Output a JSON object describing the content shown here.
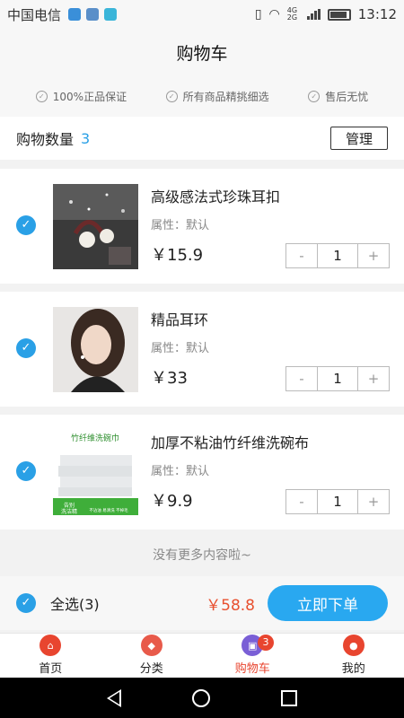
{
  "status_bar": {
    "carrier": "中国电信",
    "network": "4G 2G",
    "time": "13:12"
  },
  "header": {
    "title": "购物车"
  },
  "guarantees": [
    "100%正品保证",
    "所有商品精挑细选",
    "售后无忧"
  ],
  "cart_summary": {
    "label": "购物数量",
    "count": "3",
    "manage_label": "管理"
  },
  "items": [
    {
      "title": "高级感法式珍珠耳扣",
      "attr": "属性：默认",
      "price": "￥15.9",
      "qty": "1",
      "minus": "-",
      "plus": "+"
    },
    {
      "title": "精品耳环",
      "attr": "属性：默认",
      "price": "￥33",
      "qty": "1",
      "minus": "-",
      "plus": "+"
    },
    {
      "title": "加厚不粘油竹纤维洗碗布",
      "attr": "属性：默认",
      "price": "￥9.9",
      "qty": "1",
      "minus": "-",
      "plus": "+",
      "image_text": [
        "竹纤维洗碗巾",
        "告别",
        "洗洁精",
        "不沾油 易清洗 不掉毛"
      ]
    }
  ],
  "no_more_text": "没有更多内容啦~",
  "checkout": {
    "select_all": "全选(3)",
    "total": "￥58.8",
    "order_button": "立即下单"
  },
  "tabbar": [
    {
      "label": "首页",
      "icon": "home-icon",
      "color": "#e8452f"
    },
    {
      "label": "分类",
      "icon": "category-icon",
      "color": "#e85a4a"
    },
    {
      "label": "购物车",
      "icon": "cart-icon",
      "color": "#7a5fd6",
      "badge": "3",
      "active": true
    },
    {
      "label": "我的",
      "icon": "profile-icon",
      "color": "#e8452f"
    }
  ],
  "colors": {
    "accent": "#2aa0e6",
    "price_red": "#e8502f",
    "order_button": "#29a8f0"
  }
}
